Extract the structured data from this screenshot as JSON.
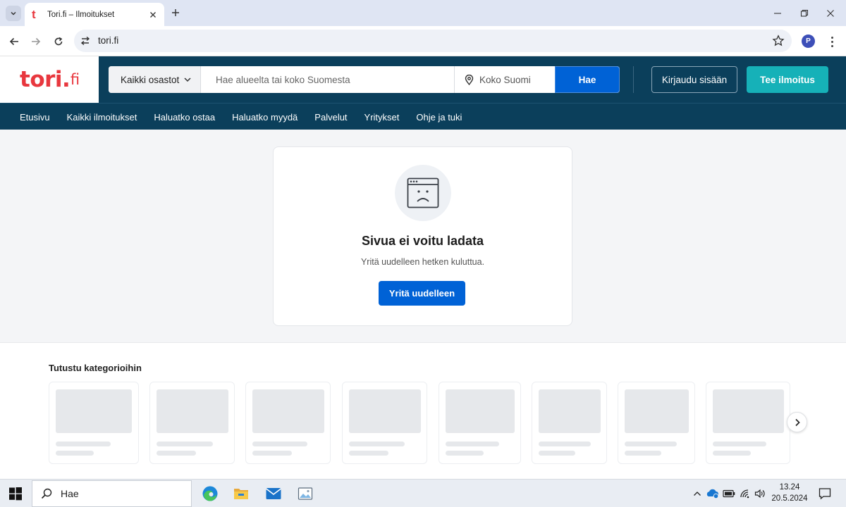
{
  "browser": {
    "tab_title": "Tori.fi – Ilmoitukset",
    "tab_favicon": "t",
    "url": "tori.fi",
    "profile_initial": "P"
  },
  "header": {
    "logo_text": "tori",
    "logo_dot": ".",
    "logo_tld": "fi",
    "department_label": "Kaikki osastot",
    "search_placeholder": "Hae alueelta tai koko Suomesta",
    "location_label": "Koko Suomi",
    "search_button": "Hae",
    "login_button": "Kirjaudu sisään",
    "post_button": "Tee ilmoitus",
    "colors": {
      "brand_red": "#e8373e",
      "header_bg": "#0b3f5b",
      "primary_blue": "#0062d6",
      "teal": "#16b1b8"
    }
  },
  "nav": {
    "items": [
      {
        "label": "Etusivu"
      },
      {
        "label": "Kaikki ilmoitukset"
      },
      {
        "label": "Haluatko ostaa"
      },
      {
        "label": "Haluatko myydä"
      },
      {
        "label": "Palvelut"
      },
      {
        "label": "Yritykset"
      },
      {
        "label": "Ohje ja tuki"
      }
    ]
  },
  "error": {
    "icon": "sad-browser-window-icon",
    "title": "Sivua ei voitu ladata",
    "subtitle": "Yritä uudelleen hetken kuluttua.",
    "retry_button": "Yritä uudelleen"
  },
  "categories": {
    "title": "Tutustu kategorioihin",
    "placeholder_count": 8
  },
  "taskbar": {
    "search_text": "Hae",
    "time": "13.24",
    "date": "20.5.2024",
    "apps": [
      "edge-icon",
      "file-explorer-icon",
      "mail-icon",
      "photos-icon"
    ]
  }
}
